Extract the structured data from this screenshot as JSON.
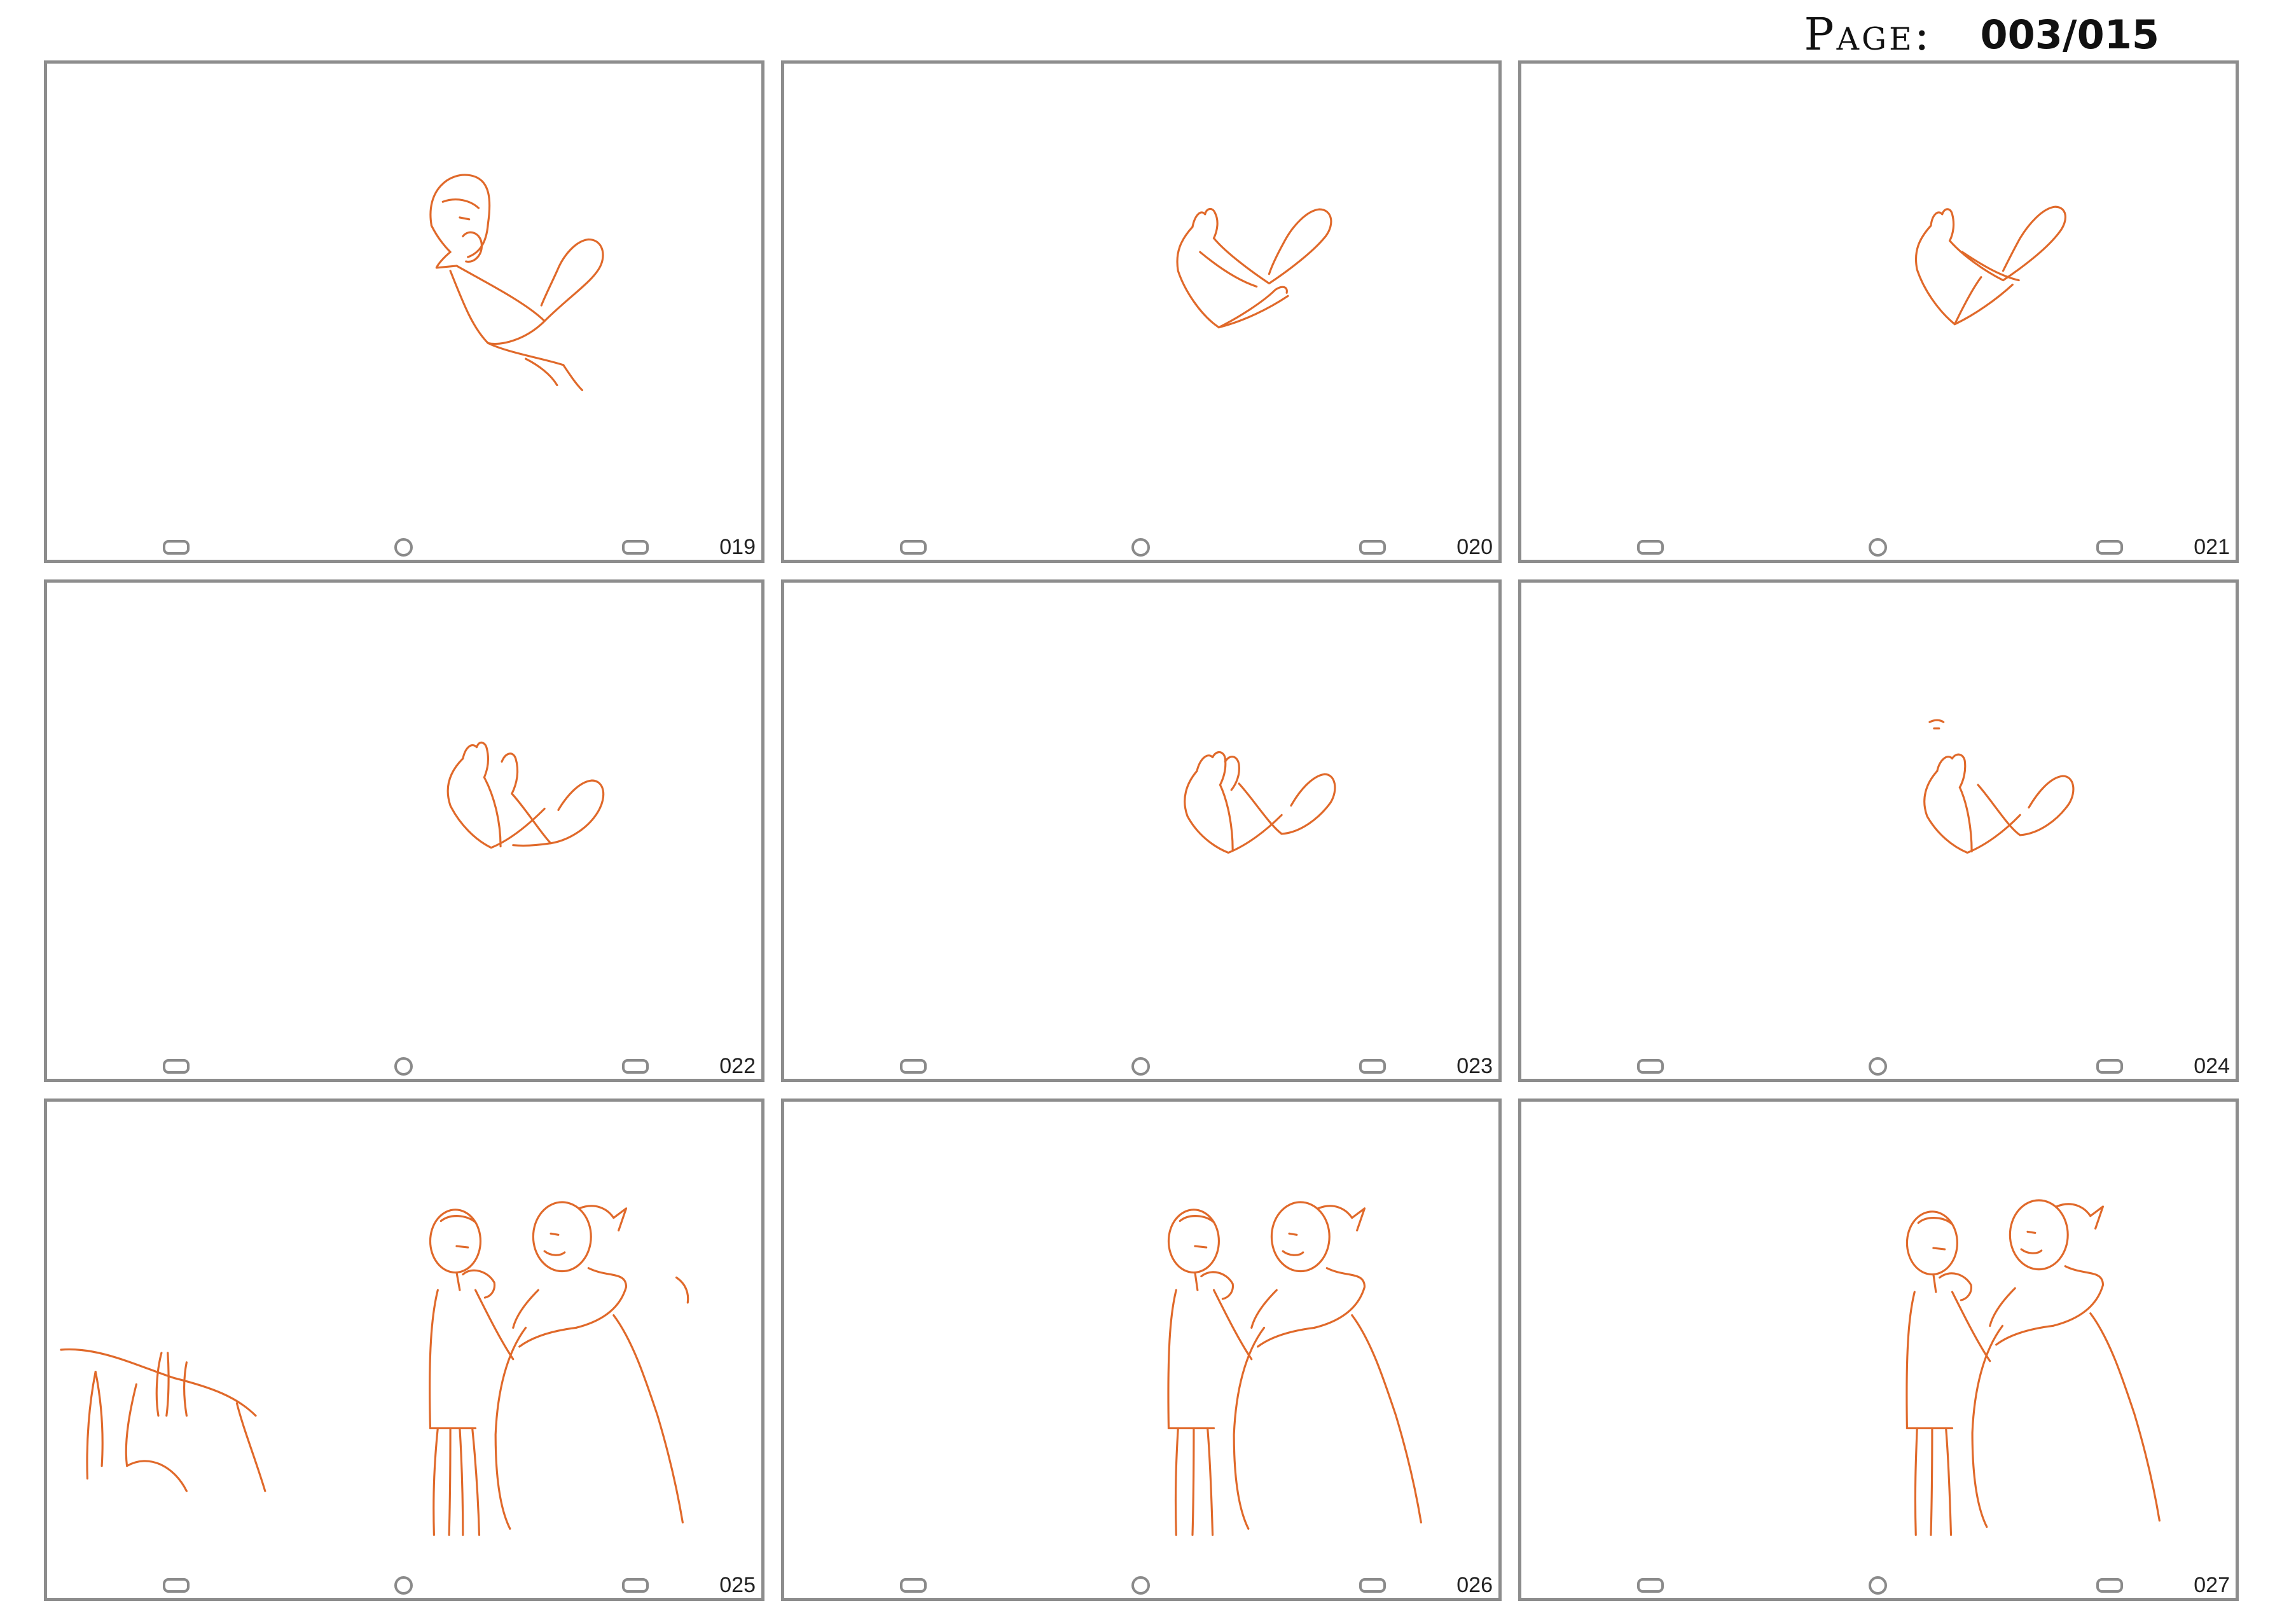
{
  "header": {
    "page_label": "Page:",
    "page_number": "003/015"
  },
  "frames": [
    {
      "number": "019",
      "pose": "figure-with-arms"
    },
    {
      "number": "020",
      "pose": "arms-crossed"
    },
    {
      "number": "021",
      "pose": "arms-crossed"
    },
    {
      "number": "022",
      "pose": "hands-raised"
    },
    {
      "number": "023",
      "pose": "hands-raised"
    },
    {
      "number": "024",
      "pose": "hands-raised"
    },
    {
      "number": "025",
      "pose": "couple-with-foreground"
    },
    {
      "number": "026",
      "pose": "couple"
    },
    {
      "number": "027",
      "pose": "couple"
    }
  ],
  "colors": {
    "sketch_line": "#e0692a",
    "frame_border": "#8d8d8d",
    "peg_hole": "#8a8a8a"
  }
}
